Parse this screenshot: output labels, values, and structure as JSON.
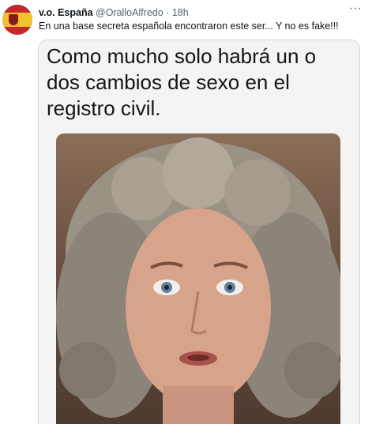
{
  "tweet": {
    "display_name": "v.o. España",
    "handle": "@OralloAlfredo",
    "separator": "·",
    "time": "18h",
    "text": "En una base secreta española encontraron este ser... Y no es fake!!!",
    "more_icon": "more-horizontal-icon"
  },
  "media": {
    "caption": "Como mucho solo habrá un o dos cambios de sexo en el registro civil.",
    "photo_description_icon": "portrait-photo"
  }
}
